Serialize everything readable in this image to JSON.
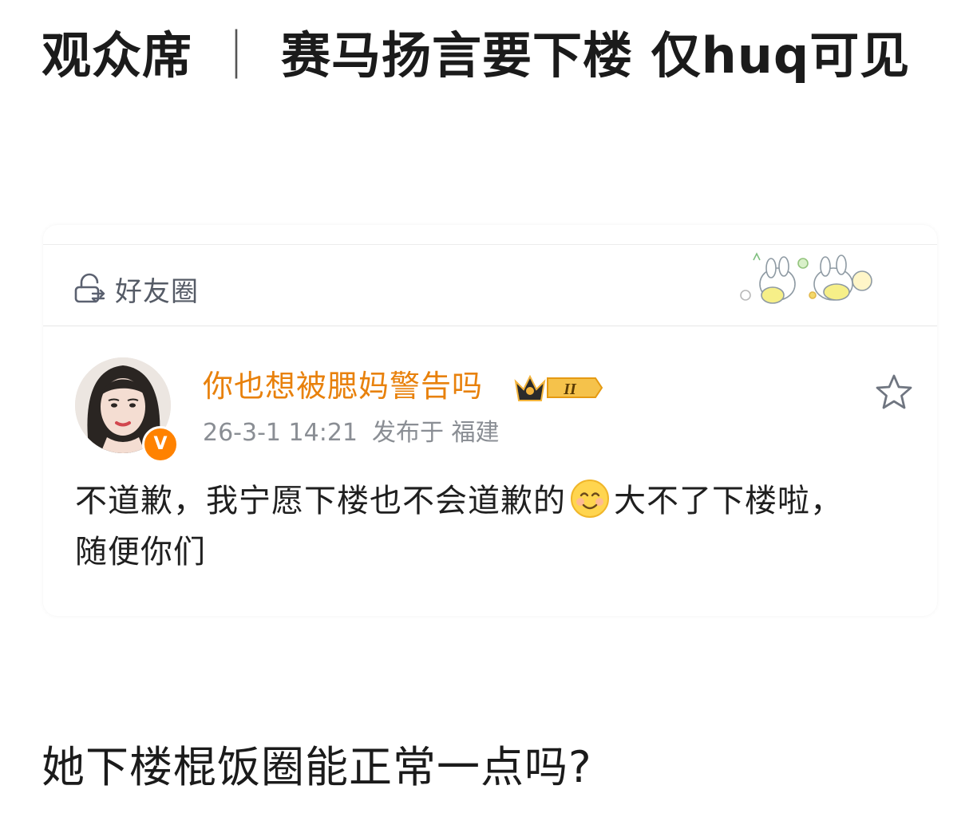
{
  "headline": {
    "part1": "观众席",
    "separator": "｜",
    "part2": "赛马扬言要下楼 仅huq可见"
  },
  "card": {
    "circle_label": "好友圈",
    "username": "你也想被腮妈警告吗",
    "vip_level": "II",
    "verified_mark": "V",
    "timestamp": "26-3-1 14:21",
    "location": "发布于 福建",
    "post_before_emoji": "不道歉，我宁愿下楼也不会道歉的",
    "post_after_emoji": "大不了下楼啦，随便你们",
    "icons": {
      "circle": "friends-circle-lock-icon",
      "favorite": "star-icon",
      "emoji": "smile-emoji-icon",
      "badge": "crown-vip-badge"
    }
  },
  "comment": "她下楼棍饭圈能正常一点吗?",
  "colors": {
    "username": "#e8810c",
    "verified": "#ff8200",
    "meta": "#8a8e94",
    "circle_label": "#555b66"
  }
}
